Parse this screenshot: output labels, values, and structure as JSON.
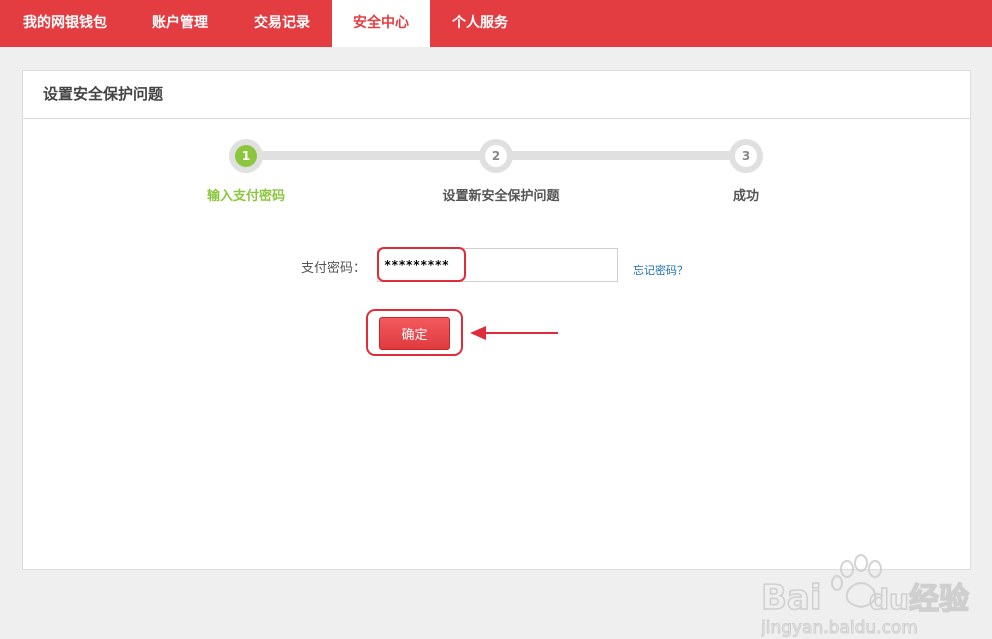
{
  "nav": {
    "tabs": [
      {
        "label": "我的网银钱包"
      },
      {
        "label": "账户管理"
      },
      {
        "label": "交易记录"
      },
      {
        "label": "安全中心"
      },
      {
        "label": "个人服务"
      }
    ],
    "active_index": 3
  },
  "panel": {
    "title": "设置安全保护问题"
  },
  "steps": [
    {
      "number": "1",
      "label": "输入支付密码",
      "status": "current"
    },
    {
      "number": "2",
      "label": "设置新安全保护问题",
      "status": "pending"
    },
    {
      "number": "3",
      "label": "成功",
      "status": "pending"
    }
  ],
  "form": {
    "password_label": "支付密码：",
    "password_value": "*********",
    "forgot_link": "忘记密码？",
    "confirm_label": "确定"
  },
  "watermark": {
    "brand": "Bai",
    "brand_suffix": "du",
    "product": "经验",
    "url": "jingyan.baidu.com"
  },
  "colors": {
    "accent": "#e43d41",
    "step_done": "#8cc63e",
    "link": "#1a6fb2",
    "annotation": "#e02c3a"
  }
}
